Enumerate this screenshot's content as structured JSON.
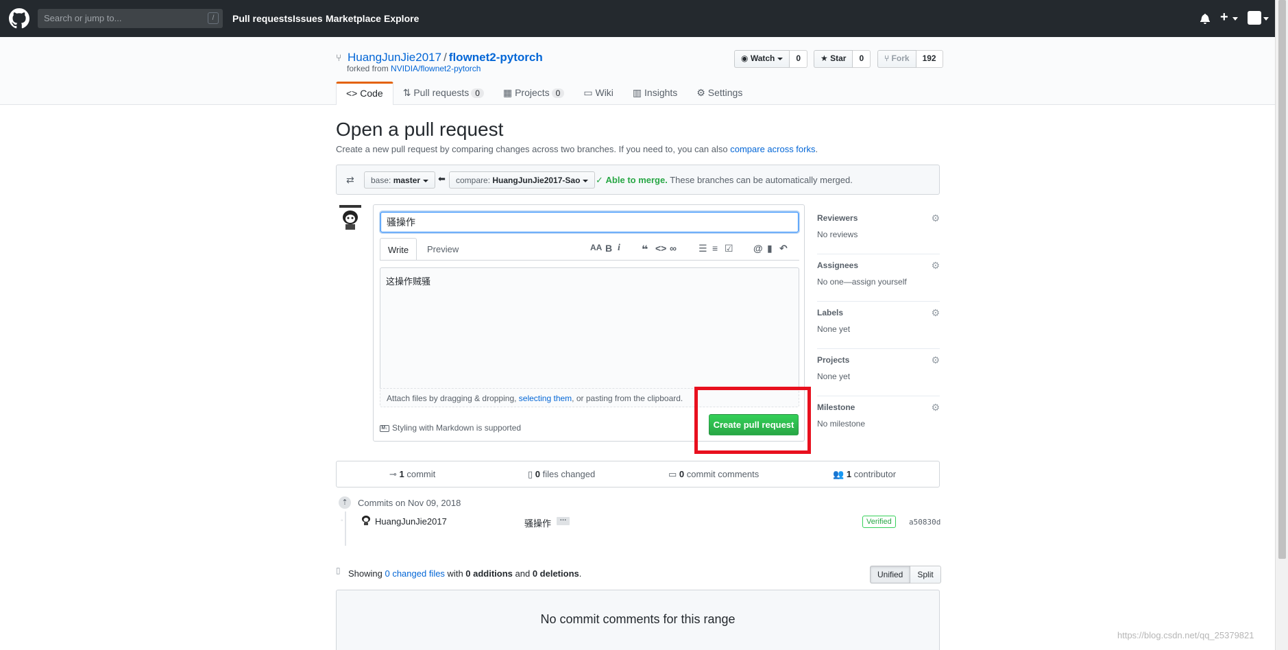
{
  "header": {
    "search_placeholder": "Search or jump to...",
    "search_key": "/",
    "nav": [
      "Pull requests",
      "Issues",
      "Marketplace",
      "Explore"
    ]
  },
  "repo": {
    "owner": "HuangJunJie2017",
    "name": "flownet2-pytorch",
    "forked_prefix": "forked from ",
    "forked_from": "NVIDIA/flownet2-pytorch",
    "watch_label": "Watch",
    "watch_count": "0",
    "star_label": "Star",
    "star_count": "0",
    "fork_label": "Fork",
    "fork_count": "192"
  },
  "tabs": {
    "code": "Code",
    "pull_requests": "Pull requests",
    "pull_requests_count": "0",
    "projects": "Projects",
    "projects_count": "0",
    "wiki": "Wiki",
    "insights": "Insights",
    "settings": "Settings"
  },
  "page": {
    "title": "Open a pull request",
    "subtitle_prefix": "Create a new pull request by comparing changes across two branches. If you need to, you can also ",
    "subtitle_link": "compare across forks",
    "subtitle_suffix": "."
  },
  "range": {
    "base_label": "base: ",
    "base_value": "master",
    "compare_label": "compare: ",
    "compare_value": "HuangJunJie2017-Sao",
    "merge_ok": "Able to merge.",
    "merge_msg": " These branches can be automatically merged."
  },
  "form": {
    "title_value": "骚操作",
    "write_tab": "Write",
    "preview_tab": "Preview",
    "body_value": "这操作贼骚",
    "attach_prefix": "Attach files by dragging & dropping, ",
    "attach_link": "selecting them",
    "attach_suffix": ", or pasting from the clipboard.",
    "markdown_note": "Styling with Markdown is supported",
    "create_button": "Create pull request"
  },
  "sidebar": [
    {
      "label": "Reviewers",
      "value": "No reviews"
    },
    {
      "label": "Assignees",
      "value": "No one—assign yourself"
    },
    {
      "label": "Labels",
      "value": "None yet"
    },
    {
      "label": "Projects",
      "value": "None yet"
    },
    {
      "label": "Milestone",
      "value": "No milestone"
    }
  ],
  "summary": {
    "commits_count": "1",
    "commits_label": " commit",
    "files_count": "0",
    "files_label": " files changed",
    "comments_count": "0",
    "comments_label": " commit comments",
    "contributors_count": "1",
    "contributors_label": " contributor"
  },
  "commits": {
    "date_heading": "Commits on Nov 09, 2018",
    "items": [
      {
        "author": "HuangJunJie2017",
        "message": "骚操作",
        "verified": "Verified",
        "sha": "a50830d"
      }
    ]
  },
  "diff": {
    "showing": "Showing ",
    "changed_files": "0 changed files",
    "with": " with ",
    "additions": "0 additions",
    "and": " and ",
    "deletions": "0 deletions",
    "end": ".",
    "unified": "Unified",
    "split": "Split"
  },
  "no_comments": "No commit comments for this range",
  "watermark": "https://blog.csdn.net/qq_25379821",
  "colors": {
    "header_bg": "#24292e",
    "create_button": "#28a745",
    "highlight_border": "#e8101e",
    "link": "#0366d6"
  }
}
